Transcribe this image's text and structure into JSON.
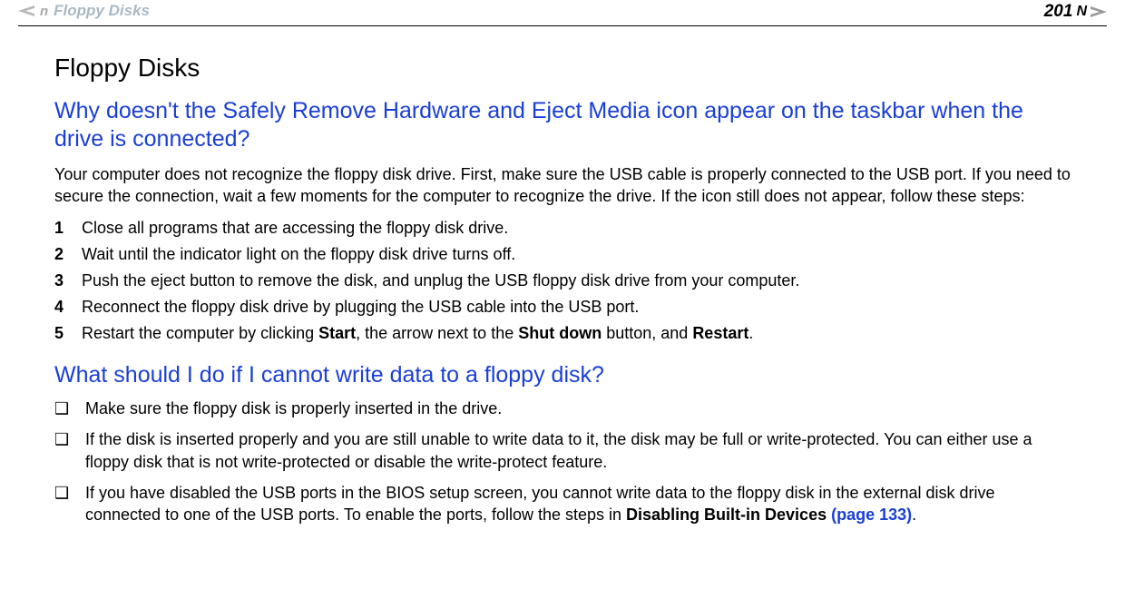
{
  "header": {
    "breadcrumb": "Floppy Disks",
    "page_number": "201",
    "n_left": "n",
    "n_right": "N"
  },
  "main": {
    "title": "Floppy Disks",
    "q1": "Why doesn't the Safely Remove Hardware and Eject Media icon appear on the taskbar when the drive is connected?",
    "intro": "Your computer does not recognize the floppy disk drive. First, make sure the USB cable is properly connected to the USB port. If you need to secure the connection, wait a few moments for the computer to recognize the drive. If the icon still does not appear, follow these steps:",
    "steps": [
      {
        "n": "1",
        "text": "Close all programs that are accessing the floppy disk drive."
      },
      {
        "n": "2",
        "text": "Wait until the indicator light on the floppy disk drive turns off."
      },
      {
        "n": "3",
        "text": "Push the eject button to remove the disk, and unplug the USB floppy disk drive from your computer."
      },
      {
        "n": "4",
        "text": "Reconnect the floppy disk drive by plugging the USB cable into the USB port."
      }
    ],
    "step5": {
      "n": "5",
      "prefix": "Restart the computer by clicking ",
      "b1": "Start",
      "mid1": ", the arrow next to the ",
      "b2": "Shut down",
      "mid2": " button, and ",
      "b3": "Restart",
      "suffix": "."
    },
    "q2": "What should I do if I cannot write data to a floppy disk?",
    "bullets": [
      "Make sure the floppy disk is properly inserted in the drive.",
      "If the disk is inserted properly and you are still unable to write data to it, the disk may be full or write-protected. You can either use a floppy disk that is not write-protected or disable the write-protect feature."
    ],
    "bullet3": {
      "prefix": "If you have disabled the USB ports in the BIOS setup screen, you cannot write data to the floppy disk in the external disk drive connected to one of the USB ports. To enable the ports, follow the steps in ",
      "bold": "Disabling Built-in Devices ",
      "link": "(page 133)",
      "suffix": "."
    }
  }
}
